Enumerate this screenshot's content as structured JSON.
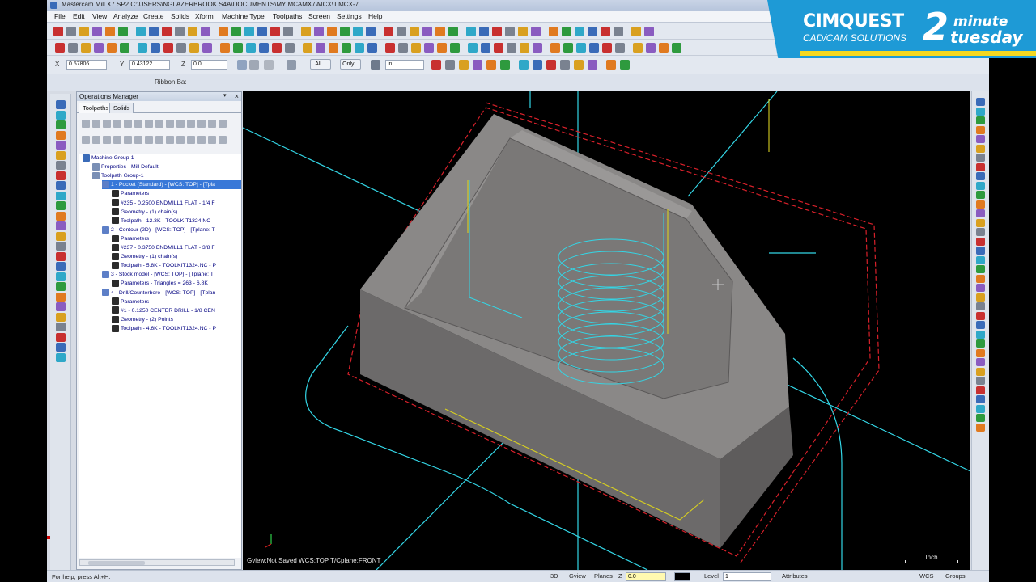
{
  "window": {
    "title": "Mastercam Mill X7 SP2  C:\\USERS\\NGLAZERBROOK.S4A\\DOCUMENTS\\MY MCAMX7\\MCX\\T.MCX-7"
  },
  "menu": [
    "File",
    "Edit",
    "View",
    "Analyze",
    "Create",
    "Solids",
    "Xform",
    "Machine Type",
    "Toolpaths",
    "Screen",
    "Settings",
    "Help"
  ],
  "coords": {
    "x_label": "X",
    "x_value": "0.57806",
    "y_label": "Y",
    "y_value": "0.43122",
    "z_label": "Z",
    "z_value": "0.0",
    "all_label": "All...",
    "only_label": "Only...",
    "units": "in"
  },
  "ribbon": {
    "label": "Ribbon Ba:"
  },
  "ops": {
    "title": "Operations Manager",
    "tabs": [
      "Toolpaths",
      "Solids"
    ],
    "tree": [
      {
        "text": "Machine Group-1",
        "indent": 0
      },
      {
        "text": "Properties - Mill Default",
        "indent": 1
      },
      {
        "text": "Toolpath Group-1",
        "indent": 1
      },
      {
        "text": "1 - Pocket (Standard) - [WCS: TOP] - [Tpla",
        "indent": 2,
        "selected": true
      },
      {
        "text": "Parameters",
        "indent": 3
      },
      {
        "text": "#235 - 0.2500 ENDMILL1 FLAT - 1/4 F",
        "indent": 3
      },
      {
        "text": "Geometry - (1) chain(s)",
        "indent": 3
      },
      {
        "text": "Toolpath - 12.3K - TOOLKIT1324.NC - ",
        "indent": 3
      },
      {
        "text": "2 - Contour (2D) - [WCS: TOP] - [Tplane: T",
        "indent": 2
      },
      {
        "text": "Parameters",
        "indent": 3
      },
      {
        "text": "#237 - 0.3750 ENDMILL1 FLAT - 3/8 F",
        "indent": 3
      },
      {
        "text": "Geometry - (1) chain(s)",
        "indent": 3
      },
      {
        "text": "Toolpath - 5.8K - TOOLKIT1324.NC - P",
        "indent": 3
      },
      {
        "text": "3 - Stock model - [WCS: TOP] - [Tplane: T",
        "indent": 2
      },
      {
        "text": "Parameters - Triangles = 263 - 6.8K",
        "indent": 3
      },
      {
        "text": "4 - Drill/Counterbore - [WCS: TOP] - [Tplan",
        "indent": 2
      },
      {
        "text": "Parameters",
        "indent": 3
      },
      {
        "text": "#1 - 0.1250 CENTER DRILL - 1/8 CEN",
        "indent": 3
      },
      {
        "text": "Geometry - (2) Points",
        "indent": 3
      },
      {
        "text": "Toolpath - 4.6K - TOOLKIT1324.NC - P",
        "indent": 3
      }
    ]
  },
  "viewport": {
    "status": "Gview:Not Saved   WCS:TOP   T/Cplane:FRONT",
    "scale_label": "Inch"
  },
  "statusbar": {
    "help": "For help, press Alt+H.",
    "mode_3d": "3D",
    "gview": "Gview",
    "planes": "Planes",
    "z_label": "Z",
    "z_value": "0.0",
    "level_label": "Level",
    "level_value": "1",
    "attributes": "Attributes",
    "wcs": "WCS",
    "groups": "Groups"
  },
  "brand": {
    "name": "CIMQUEST",
    "sub": "CAD/CAM SOLUTIONS",
    "num": "2",
    "minute": "minute",
    "tuesday": "tuesday"
  },
  "colors": {
    "accent": "#1e9ad6",
    "stripe": "#f5d820",
    "toolpath": "#33d6e6",
    "stock": "#7b7978",
    "boundary": "#d8202a",
    "chain": "#d8d020"
  }
}
